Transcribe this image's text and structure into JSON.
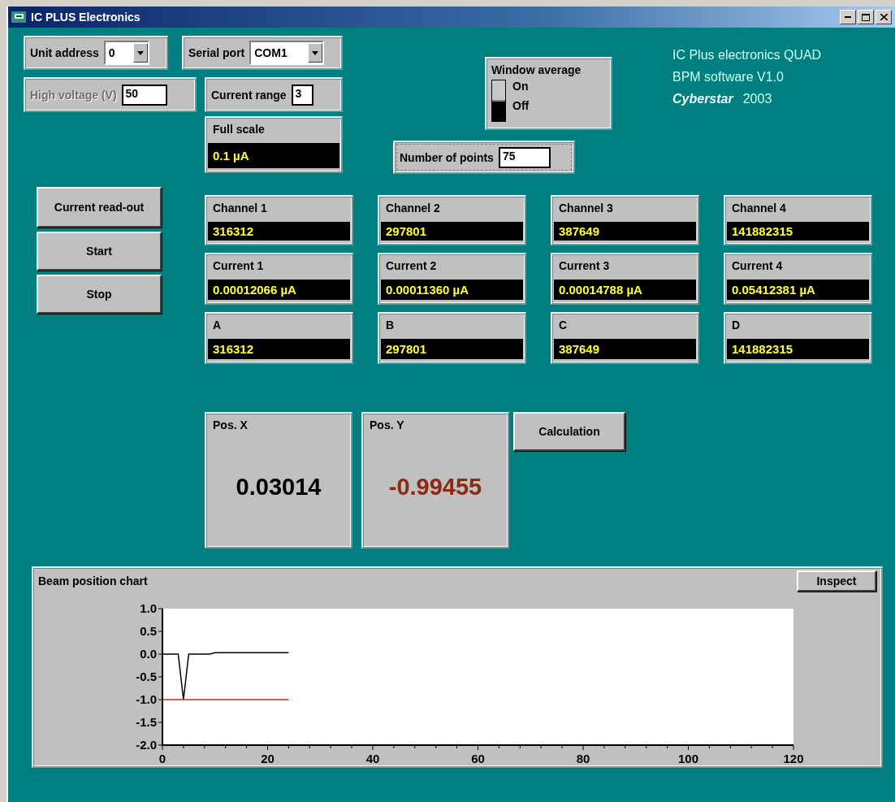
{
  "window": {
    "title": "IC PLUS Electronics"
  },
  "unit_address": {
    "label": "Unit address",
    "value": "0"
  },
  "serial_port": {
    "label": "Serial port",
    "value": "COM1"
  },
  "high_voltage": {
    "label": "High voltage (V)",
    "value": "50",
    "disabled": true
  },
  "current_range": {
    "label": "Current range",
    "value": "3"
  },
  "full_scale": {
    "label": "Full scale",
    "value": "0.1 µA"
  },
  "window_average": {
    "label": "Window average",
    "on_label": "On",
    "off_label": "Off",
    "on": false
  },
  "number_of_points": {
    "label": "Number of points",
    "value": "75"
  },
  "info": {
    "line_1": "IC Plus electronics QUAD",
    "line_2": "BPM software V1.0",
    "author": "Cyberstar",
    "year": "2003"
  },
  "buttons": [
    "Current read-out",
    "Start",
    "Stop"
  ],
  "readouts": [
    {
      "label": "Channel 1",
      "value": "316312"
    },
    {
      "label": "Channel 2",
      "value": "297801"
    },
    {
      "label": "Channel 3",
      "value": "387649"
    },
    {
      "label": "Channel 4",
      "value": "141882315"
    },
    {
      "label": "Current 1",
      "value": "0.00012066 µA"
    },
    {
      "label": "Current 2",
      "value": "0.00011360 µA"
    },
    {
      "label": "Current 3",
      "value": "0.00014788 µA"
    },
    {
      "label": "Current 4",
      "value": "0.05412381 µA"
    },
    {
      "label": "A",
      "value": "316312"
    },
    {
      "label": "B",
      "value": "297801"
    },
    {
      "label": "C",
      "value": "387649"
    },
    {
      "label": "D",
      "value": "141882315"
    }
  ],
  "positions": [
    {
      "label": "Pos. X",
      "value": "0.03014",
      "color": "#000000"
    },
    {
      "label": "Pos. Y",
      "value": "-0.99455",
      "color": "#8b2a10"
    }
  ],
  "calculation_button": "Calculation",
  "chart": {
    "title": "Beam position chart",
    "inspect_button": "Inspect",
    "chart_data": {
      "type": "line",
      "x": [
        0,
        1,
        2,
        3,
        4,
        5,
        6,
        7,
        8,
        9,
        10,
        11,
        12,
        13,
        14,
        15,
        16,
        17,
        18,
        19,
        20,
        21,
        22,
        23,
        24
      ],
      "series": [
        {
          "color": "#000000",
          "values": [
            0,
            0,
            0,
            0,
            -1,
            0,
            0,
            0,
            0,
            0,
            0.03,
            0.03,
            0.03,
            0.03,
            0.03,
            0.03,
            0.03,
            0.03,
            0.03,
            0.03,
            0.03,
            0.03,
            0.03,
            0.03,
            0.03
          ]
        },
        {
          "color": "#e02020",
          "values": [
            -1,
            -1,
            -1,
            -1,
            -1,
            -1,
            -1,
            -1,
            -1,
            -1,
            -1,
            -1,
            -1,
            -1,
            -1,
            -1,
            -1,
            -1,
            -1,
            -1,
            -1,
            -1,
            -1,
            -1,
            -1
          ]
        }
      ],
      "xlim": [
        0,
        120
      ],
      "ylim": [
        -2,
        1
      ],
      "xticks": [
        0,
        20,
        40,
        60,
        80,
        100,
        120
      ],
      "yticks": [
        {
          "value": 1,
          "label": "1.0"
        },
        {
          "value": 0.5,
          "label": "0.5"
        },
        {
          "value": 0,
          "label": "0.0"
        },
        {
          "value": -0.5,
          "label": "-0.5"
        },
        {
          "value": -1,
          "label": "-1.0"
        },
        {
          "value": -1.5,
          "label": "-1.5"
        },
        {
          "value": -2,
          "label": "-2.0"
        }
      ]
    }
  }
}
